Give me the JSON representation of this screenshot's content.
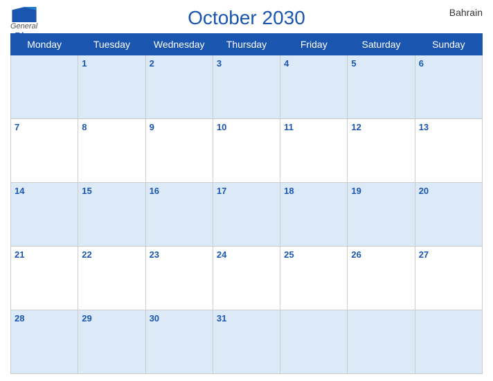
{
  "header": {
    "logo_general": "General",
    "logo_blue": "Blue",
    "title": "October 2030",
    "country": "Bahrain"
  },
  "calendar": {
    "days_of_week": [
      "Monday",
      "Tuesday",
      "Wednesday",
      "Thursday",
      "Friday",
      "Saturday",
      "Sunday"
    ],
    "weeks": [
      [
        null,
        1,
        2,
        3,
        4,
        5,
        6
      ],
      [
        7,
        8,
        9,
        10,
        11,
        12,
        13
      ],
      [
        14,
        15,
        16,
        17,
        18,
        19,
        20
      ],
      [
        21,
        22,
        23,
        24,
        25,
        26,
        27
      ],
      [
        28,
        29,
        30,
        31,
        null,
        null,
        null
      ]
    ]
  }
}
